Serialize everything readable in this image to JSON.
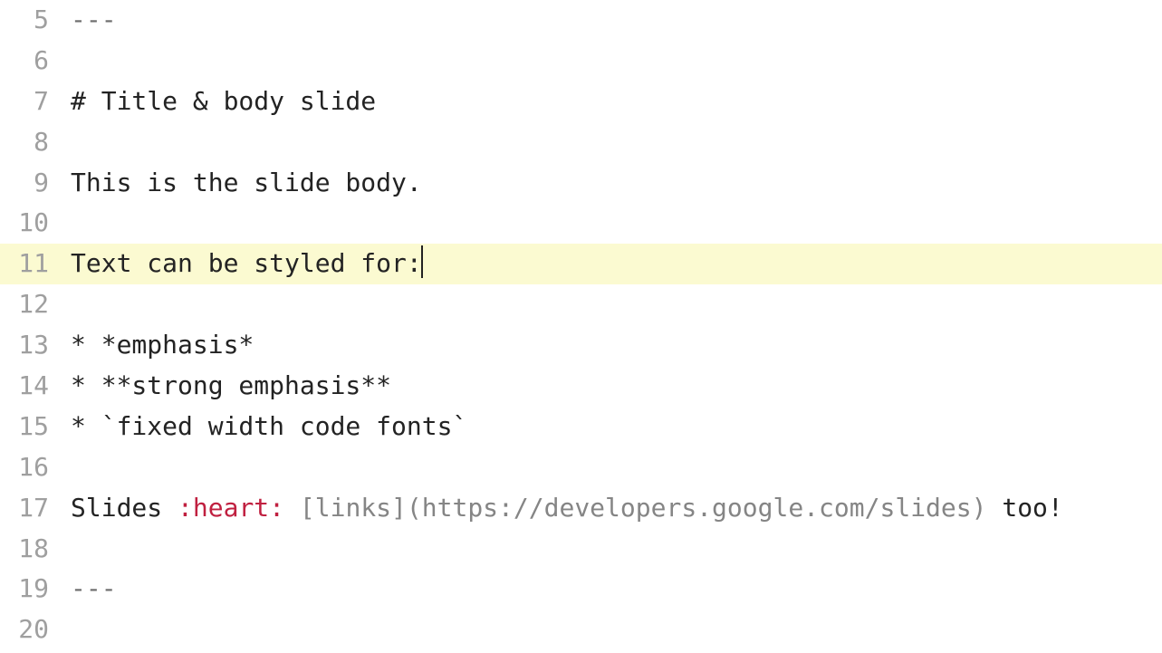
{
  "lines": [
    {
      "num": 5,
      "hl": false,
      "segs": [
        {
          "cls": "punct",
          "t": "---"
        }
      ]
    },
    {
      "num": 6,
      "hl": false,
      "segs": []
    },
    {
      "num": 7,
      "hl": false,
      "segs": [
        {
          "cls": "",
          "t": "# Title & body slide"
        }
      ]
    },
    {
      "num": 8,
      "hl": false,
      "segs": []
    },
    {
      "num": 9,
      "hl": false,
      "segs": [
        {
          "cls": "",
          "t": "This is the slide body."
        }
      ]
    },
    {
      "num": 10,
      "hl": false,
      "segs": []
    },
    {
      "num": 11,
      "hl": true,
      "segs": [
        {
          "cls": "",
          "t": "Text can be styled for:"
        }
      ],
      "cursor": true
    },
    {
      "num": 12,
      "hl": false,
      "segs": []
    },
    {
      "num": 13,
      "hl": false,
      "segs": [
        {
          "cls": "",
          "t": "* *emphasis*"
        }
      ]
    },
    {
      "num": 14,
      "hl": false,
      "segs": [
        {
          "cls": "",
          "t": "* **strong emphasis**"
        }
      ]
    },
    {
      "num": 15,
      "hl": false,
      "segs": [
        {
          "cls": "",
          "t": "* `fixed width code fonts`"
        }
      ]
    },
    {
      "num": 16,
      "hl": false,
      "segs": []
    },
    {
      "num": 17,
      "hl": false,
      "segs": [
        {
          "cls": "",
          "t": "Slides "
        },
        {
          "cls": "emoji",
          "t": ":heart:"
        },
        {
          "cls": "",
          "t": " "
        },
        {
          "cls": "link",
          "t": "[links](https://developers.google.com/slides)"
        },
        {
          "cls": "",
          "t": " too!"
        }
      ]
    },
    {
      "num": 18,
      "hl": false,
      "segs": []
    },
    {
      "num": 19,
      "hl": false,
      "segs": [
        {
          "cls": "punct",
          "t": "---"
        }
      ]
    },
    {
      "num": 20,
      "hl": false,
      "segs": []
    }
  ]
}
